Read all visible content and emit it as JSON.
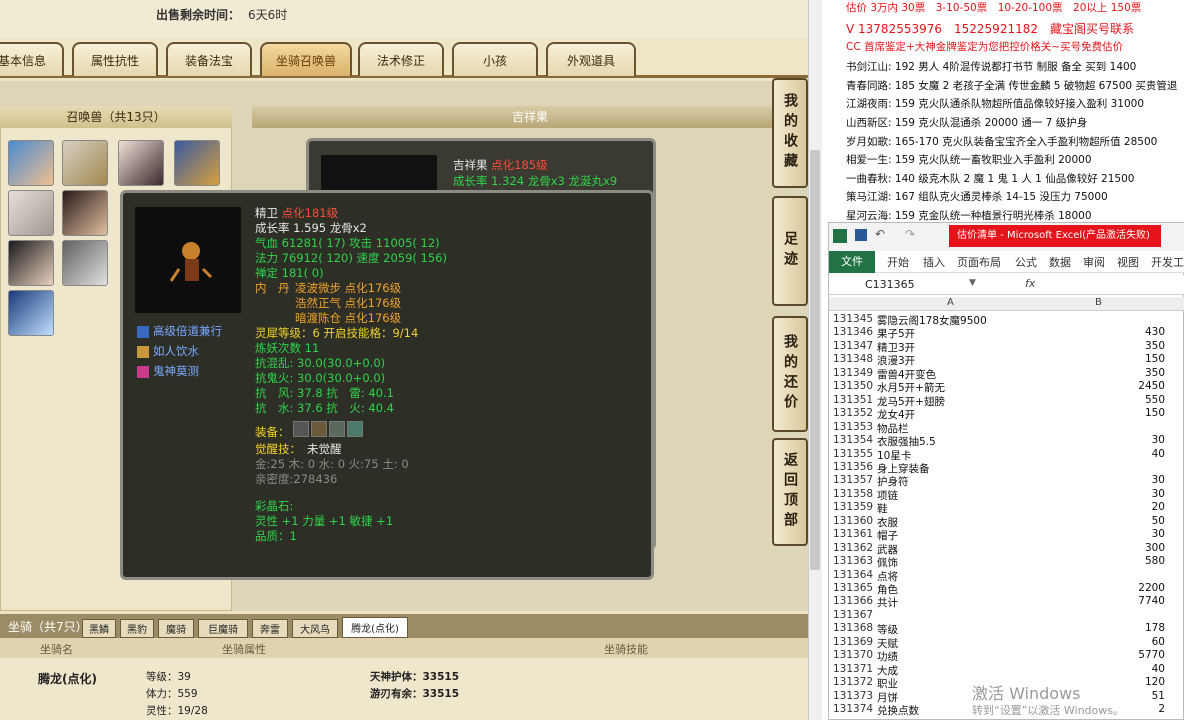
{
  "game": {
    "sale_time_label": "出售剩余时间：",
    "sale_time_value": "6天6时",
    "tabs": [
      "基本信息",
      "属性抗性",
      "装备法宝",
      "坐骑召唤兽",
      "法术修正",
      "小孩",
      "外观道具"
    ],
    "active_tab": "坐骑召唤兽",
    "pet_list_title": "召唤兽（共13只）",
    "selected_pet_header": "吉祥果",
    "side_buttons": [
      "我的收藏",
      "足迹",
      "我的还价",
      "返回顶部"
    ],
    "back_tip": {
      "name": "吉祥果",
      "level": "点化185级",
      "growth": "成长率 1.324 龙骨x3 龙涎丸x9"
    },
    "tip": {
      "name": "精卫",
      "level": "点化181级",
      "growth": "成长率 1.595 龙骨x2",
      "hp": "气血 61281( 17) 攻击 11005( 12)",
      "mp": "法力 76912( 120) 速度 2059( 156)",
      "chan": "禅定 181( 0)",
      "neidan_label": "内　丹",
      "neidan": [
        "凌波微步 点化176级",
        "浩然正气 点化176级",
        "暗渡陈仓 点化176级"
      ],
      "lingxi": "灵犀等级：6 开启技能格：9/14",
      "lianyao": "炼妖次数 11",
      "kang1": "抗混乱: 30.0(30.0+0.0)",
      "kang2": "抗鬼火: 30.0(30.0+0.0)",
      "kang3": "抗　风: 37.8 抗　雷: 40.1",
      "kang4": "抗　水: 37.6 抗　火: 40.4",
      "equip_label": "装备：",
      "awaken_label": "觉醒技：",
      "awaken_value": "未觉醒",
      "wuxing": "金:25 木: 0 水: 0 火:75 土: 0",
      "qinmi": "亲密度:278436",
      "caijing_label": "彩晶石:",
      "caijing": "灵性 +1 力量 +1 敏捷 +1",
      "pinzhi": "品质：1",
      "skills": [
        "高级倍道兼行",
        "如人饮水",
        "鬼神莫测"
      ]
    },
    "mount": {
      "title": "坐骑（共7只）",
      "tabs": [
        "黑鳞",
        "黑豹",
        "魔骑",
        "巨魔骑",
        "奔雷",
        "大风鸟",
        "腾龙(点化)"
      ],
      "headers": [
        "坐骑名",
        "坐骑属性",
        "坐骑技能"
      ],
      "name": "腾龙(点化)",
      "attrs": [
        "等级：39",
        "体力：559",
        "灵性：19/28"
      ],
      "skills": [
        "天神护体：33515",
        "游刃有余：33515"
      ]
    }
  },
  "ad": {
    "line1": "估价 3万内 30票　3-10-50票　10-20-100票　20以上 150票",
    "line2": "V 13782553976　15225921182　藏宝阁买号联系",
    "line3": "CC 首席鉴定+大神金牌鉴定为您把控价格关~买号免费估价",
    "servers": [
      [
        "书剑江山:",
        "192 男人 4阶混传说都打书节 制服 备全 买到 1400"
      ],
      [
        "青春同路:",
        "185 女魔 2 老孩子全满 传世金麟 5 破物超 67500 买贵管退"
      ],
      [
        "江湖夜雨:",
        "159 克火队通杀队物超所值品像较好接入盈利 31000"
      ],
      [
        "山西新区:",
        "159 克火队混通杀 20000 通一 7 级护身"
      ],
      [
        "岁月如歌:",
        "165-170 克火队装备宝宝齐全入手盈利物超所值 28500"
      ],
      [
        "相爱一生:",
        "159 克火队统一畜牧职业入手盈利 20000"
      ],
      [
        "一曲春秋:",
        "140 级克木队 2 魔 1 鬼 1 人 1 仙品像较好 21500"
      ],
      [
        "策马江湖:",
        "167 组队克火通灵棒杀 14-15 没压力 75000"
      ],
      [
        "星河云海:",
        "159 克金队统一种植景行明光棒杀 18000"
      ]
    ]
  },
  "excel": {
    "title": "估价清单 - Microsoft Excel(产品激活失败)",
    "ribbon": [
      "文件",
      "开始",
      "插入",
      "页面布局",
      "公式",
      "数据",
      "审阅",
      "视图",
      "开发工"
    ],
    "cell_ref": "C131365",
    "fx": "fx",
    "col_a": "A",
    "col_b": "B",
    "rows": [
      [
        "131345",
        "雾隐云阁178女魔9500",
        ""
      ],
      [
        "131346",
        "果子5开",
        "430"
      ],
      [
        "131347",
        "精卫3开",
        "350"
      ],
      [
        "131348",
        "浪漫3开",
        "150"
      ],
      [
        "131349",
        "雷兽4开变色",
        "350"
      ],
      [
        "131350",
        "水月5开+箭无",
        "2450"
      ],
      [
        "131351",
        "龙马5开+翅膀",
        "550"
      ],
      [
        "131352",
        "龙女4开",
        "150"
      ],
      [
        "131353",
        "物品栏",
        ""
      ],
      [
        "131354",
        "衣服强抽5.5",
        "30"
      ],
      [
        "131355",
        "10星卡",
        "40"
      ],
      [
        "131356",
        "身上穿装备",
        ""
      ],
      [
        "131357",
        "护身符",
        "30"
      ],
      [
        "131358",
        "项链",
        "30"
      ],
      [
        "131359",
        "鞋",
        "20"
      ],
      [
        "131360",
        "衣服",
        "50"
      ],
      [
        "131361",
        "帽子",
        "30"
      ],
      [
        "131362",
        "武器",
        "300"
      ],
      [
        "131363",
        "佩饰",
        "580"
      ],
      [
        "131364",
        "点将",
        ""
      ],
      [
        "131365",
        "角色",
        "2200"
      ],
      [
        "131366",
        "共计",
        "7740"
      ],
      [
        "131367",
        "",
        ""
      ],
      [
        "131368",
        "等级",
        "178"
      ],
      [
        "131369",
        "天赋",
        "60"
      ],
      [
        "131370",
        "功绩",
        "5770"
      ],
      [
        "131371",
        "大成",
        "40"
      ],
      [
        "131372",
        "职业",
        "120"
      ],
      [
        "131373",
        "月饼",
        "51"
      ],
      [
        "131374",
        "兑换点数",
        "2"
      ]
    ]
  },
  "watermark": {
    "line1": "激活 Windows",
    "line2": "转到“设置”以激活 Windows。"
  },
  "colors": {
    "accent": "#8a6a3a",
    "tooltip_bg": "#2d2f27",
    "excel_green": "#217346",
    "ad_red": "#e5141a"
  }
}
